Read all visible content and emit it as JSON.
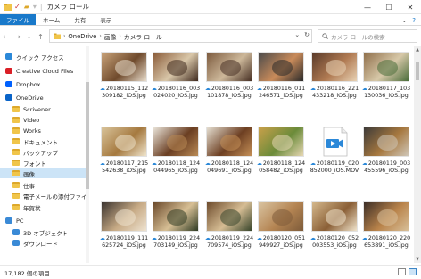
{
  "window": {
    "title": "カメラ ロール",
    "controls": {
      "minimize": "—",
      "maximize": "☐",
      "close": "✕"
    }
  },
  "ribbon": {
    "tabs": [
      "ファイル",
      "ホーム",
      "共有",
      "表示"
    ],
    "help": "?"
  },
  "address": {
    "crumbs": [
      "OneDrive",
      "画像",
      "カメラ ロール"
    ],
    "search_placeholder": "カメラ ロールの検索"
  },
  "nav": {
    "items": [
      {
        "label": "クイック アクセス",
        "icon": "star-icon",
        "indent": 0
      },
      {
        "label": "Creative Cloud Files",
        "icon": "creative-cloud-icon",
        "indent": 0
      },
      {
        "label": "Dropbox",
        "icon": "dropbox-icon",
        "indent": 0
      },
      {
        "label": "OneDrive",
        "icon": "onedrive-icon",
        "indent": 0
      },
      {
        "label": "Scrivener",
        "icon": "folder-icon",
        "indent": 1
      },
      {
        "label": "Video",
        "icon": "folder-icon",
        "indent": 1
      },
      {
        "label": "Works",
        "icon": "folder-icon",
        "indent": 1
      },
      {
        "label": "ドキュメント",
        "icon": "folder-icon",
        "indent": 1
      },
      {
        "label": "バックアップ",
        "icon": "folder-icon",
        "indent": 1
      },
      {
        "label": "フォント",
        "icon": "folder-icon",
        "indent": 1
      },
      {
        "label": "画像",
        "icon": "folder-icon",
        "indent": 1,
        "selected": true
      },
      {
        "label": "仕事",
        "icon": "folder-icon",
        "indent": 1
      },
      {
        "label": "電子メールの添付ファイル",
        "icon": "folder-icon",
        "indent": 1
      },
      {
        "label": "年賀状",
        "icon": "folder-icon",
        "indent": 1
      },
      {
        "label": "PC",
        "icon": "pc-icon",
        "indent": 0
      },
      {
        "label": "3D オブジェクト",
        "icon": "3d-objects-icon",
        "indent": 1
      },
      {
        "label": "ダウンロード",
        "icon": "download-icon",
        "indent": 1
      }
    ]
  },
  "files": [
    {
      "name": "20180115_112309182_iOS.jpg",
      "thumb": [
        "#c9a37a",
        "#6f4a2c",
        "#e7dccb"
      ]
    },
    {
      "name": "20180116_003024020_iOS.jpg",
      "thumb": [
        "#8a5b39",
        "#d9c7a9",
        "#3f2a1e"
      ]
    },
    {
      "name": "20180116_003101878_iOS.jpg",
      "thumb": [
        "#7c5a3e",
        "#cdb89a",
        "#473024"
      ]
    },
    {
      "name": "20180116_011246571_iOS.jpg",
      "thumb": [
        "#4b4b4b",
        "#c98b5a",
        "#2a2a2a"
      ]
    },
    {
      "name": "20180116_221433218_iOS.jpg",
      "thumb": [
        "#5a3b2a",
        "#b07a52",
        "#e8d2b4"
      ]
    },
    {
      "name": "20180117_103130036_iOS.jpg",
      "thumb": [
        "#8f6f4b",
        "#d7c8a8",
        "#4a6d3a"
      ]
    },
    {
      "name": "20180117_215542638_iOS.jpg",
      "thumb": [
        "#d8c39a",
        "#a5793f",
        "#efe4cc"
      ]
    },
    {
      "name": "20180118_124044965_iOS.jpg",
      "thumb": [
        "#e9e3d8",
        "#6a3e22",
        "#b98a55"
      ]
    },
    {
      "name": "20180118_124049691_iOS.jpg",
      "thumb": [
        "#e4ddd0",
        "#6d3f22",
        "#c48f57"
      ]
    },
    {
      "name": "20180118_124058482_iOS.jpg",
      "thumb": [
        "#c9a04a",
        "#6b8b3a",
        "#e6d7b2"
      ]
    },
    {
      "name": "20180119_020852000_iOS.MOV",
      "video": true
    },
    {
      "name": "20180119_003455596_iOS.jpg",
      "thumb": [
        "#3d3b39",
        "#a6783f",
        "#d0c7b8"
      ]
    },
    {
      "name": "20180119_111625724_iOS.jpg",
      "thumb": [
        "#3b3430",
        "#c7aa85",
        "#eee3d0"
      ]
    },
    {
      "name": "20180119_224703149_iOS.jpg",
      "thumb": [
        "#6b4a2c",
        "#d7bf95",
        "#2f3b23"
      ]
    },
    {
      "name": "20180119_224709574_iOS.jpg",
      "thumb": [
        "#6e4c2d",
        "#d6bd94",
        "#38452b"
      ]
    },
    {
      "name": "20180120_051949927_iOS.jpg",
      "thumb": [
        "#d9c3a0",
        "#b48452",
        "#7d5b3a"
      ]
    },
    {
      "name": "20180120_052003553_iOS.jpg",
      "thumb": [
        "#d4b88c",
        "#8a5f36",
        "#f0e4cc"
      ]
    },
    {
      "name": "20180120_220653891_iOS.jpg",
      "thumb": [
        "#3c2f27",
        "#b9834a",
        "#d8c09a"
      ]
    }
  ],
  "status": {
    "count": "17,182 個の項目"
  },
  "colors": {
    "accent": "#1979ca",
    "selected": "#cce4f7",
    "cloud": "#2b88d8"
  }
}
